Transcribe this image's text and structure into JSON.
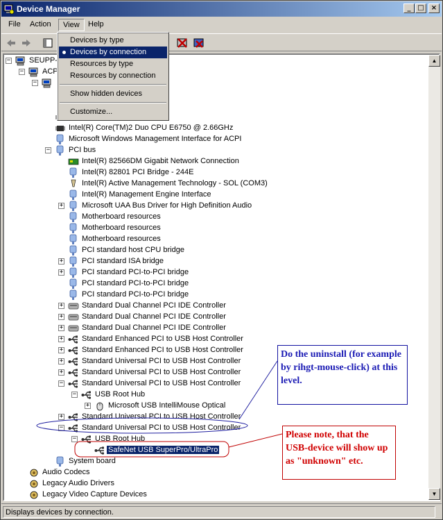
{
  "window": {
    "title": "Device Manager",
    "buttons": {
      "minimize": "_",
      "maximize": "□",
      "close": "×"
    }
  },
  "menubar": {
    "items": [
      {
        "label": "File"
      },
      {
        "label": "Action"
      },
      {
        "label": "View"
      },
      {
        "label": "Help"
      }
    ]
  },
  "view_menu": {
    "items": [
      {
        "label": "Devices by type",
        "checked": false,
        "highlighted": false
      },
      {
        "label": "Devices by connection",
        "checked": true,
        "highlighted": true
      },
      {
        "label": "Resources by type",
        "checked": false,
        "highlighted": false
      },
      {
        "label": "Resources by connection",
        "checked": false,
        "highlighted": false
      },
      {
        "label": "Show hidden devices",
        "checked": false,
        "highlighted": false
      },
      {
        "label": "Customize...",
        "checked": false,
        "highlighted": false
      }
    ]
  },
  "tree": {
    "items": [
      {
        "label": "SEUPP-M",
        "icon": "computer-icon",
        "expander": "minus"
      },
      {
        "label": "ACP",
        "icon": "computer-icon",
        "expander": "minus"
      },
      {
        "label": "",
        "icon": "computer-icon",
        "expander": "minus"
      },
      {
        "label": "E6750  @ 2.66GHz",
        "icon": "cpu-icon",
        "expander": ""
      },
      {
        "label": "Intel(R) Core(TM)2 Duo CPU      E6750  @ 2.66GHz",
        "icon": "cpu-icon",
        "expander": ""
      },
      {
        "label": "Microsoft Windows Management Interface for ACPI",
        "icon": "device-icon",
        "expander": ""
      },
      {
        "label": "PCI bus",
        "icon": "device-icon",
        "expander": "minus"
      },
      {
        "label": "Intel(R) 82566DM Gigabit Network Connection",
        "icon": "network-card-icon",
        "expander": ""
      },
      {
        "label": "Intel(R) 82801 PCI Bridge - 244E",
        "icon": "device-icon",
        "expander": ""
      },
      {
        "label": "Intel(R) Active Management Technology - SOL (COM3)",
        "icon": "port-icon",
        "expander": ""
      },
      {
        "label": "Intel(R) Management Engine Interface",
        "icon": "device-icon",
        "expander": ""
      },
      {
        "label": "Microsoft UAA Bus Driver for High Definition Audio",
        "icon": "device-icon",
        "expander": "plus"
      },
      {
        "label": "Motherboard resources",
        "icon": "device-icon",
        "expander": ""
      },
      {
        "label": "Motherboard resources",
        "icon": "device-icon",
        "expander": ""
      },
      {
        "label": "Motherboard resources",
        "icon": "device-icon",
        "expander": ""
      },
      {
        "label": "PCI standard host CPU bridge",
        "icon": "device-icon",
        "expander": ""
      },
      {
        "label": "PCI standard ISA bridge",
        "icon": "device-icon",
        "expander": "plus"
      },
      {
        "label": "PCI standard PCI-to-PCI bridge",
        "icon": "device-icon",
        "expander": "plus"
      },
      {
        "label": "PCI standard PCI-to-PCI bridge",
        "icon": "device-icon",
        "expander": ""
      },
      {
        "label": "PCI standard PCI-to-PCI bridge",
        "icon": "device-icon",
        "expander": ""
      },
      {
        "label": "Standard Dual Channel PCI IDE Controller",
        "icon": "ide-controller-icon",
        "expander": "plus"
      },
      {
        "label": "Standard Dual Channel PCI IDE Controller",
        "icon": "ide-controller-icon",
        "expander": "plus"
      },
      {
        "label": "Standard Dual Channel PCI IDE Controller",
        "icon": "ide-controller-icon",
        "expander": "plus"
      },
      {
        "label": "Standard Enhanced PCI to USB Host Controller",
        "icon": "usb-icon",
        "expander": "plus"
      },
      {
        "label": "Standard Enhanced PCI to USB Host Controller",
        "icon": "usb-icon",
        "expander": "plus"
      },
      {
        "label": "Standard Universal PCI to USB Host Controller",
        "icon": "usb-icon",
        "expander": "plus"
      },
      {
        "label": "Standard Universal PCI to USB Host Controller",
        "icon": "usb-icon",
        "expander": "plus"
      },
      {
        "label": "Standard Universal PCI to USB Host Controller",
        "icon": "usb-icon",
        "expander": "minus"
      },
      {
        "label": "USB Root Hub",
        "icon": "usb-icon",
        "expander": "minus"
      },
      {
        "label": "Microsoft USB IntelliMouse Optical",
        "icon": "mouse-icon",
        "expander": "plus"
      },
      {
        "label": "Standard Universal PCI to USB Host Controller",
        "icon": "usb-icon",
        "expander": "plus"
      },
      {
        "label": "Standard Universal PCI to USB Host Controller",
        "icon": "usb-icon",
        "expander": "minus"
      },
      {
        "label": "USB Root Hub",
        "icon": "usb-icon",
        "expander": "minus"
      },
      {
        "label": "SafeNet USB SuperPro/UltraPro",
        "icon": "usb-icon",
        "expander": "",
        "selected": true
      },
      {
        "label": "System board",
        "icon": "device-icon",
        "expander": ""
      },
      {
        "label": "Audio Codecs",
        "icon": "audio-icon",
        "expander": ""
      },
      {
        "label": "Legacy Audio Drivers",
        "icon": "audio-icon",
        "expander": ""
      },
      {
        "label": "Legacy Video Capture Devices",
        "icon": "audio-icon",
        "expander": ""
      },
      {
        "label": "",
        "icon": "audio-icon",
        "expander": ""
      }
    ]
  },
  "callouts": {
    "uninstall": "Do the uninstall (for example by rihgt-mouse-click) at this level.",
    "note": "Please note, that the USB-device will show up as \"unknown\" etc."
  },
  "statusbar": {
    "text": "Displays devices by connection."
  },
  "colors": {
    "selection": "#0a246a",
    "callout_blue": "#1a1ab4",
    "callout_red": "#d00000"
  }
}
